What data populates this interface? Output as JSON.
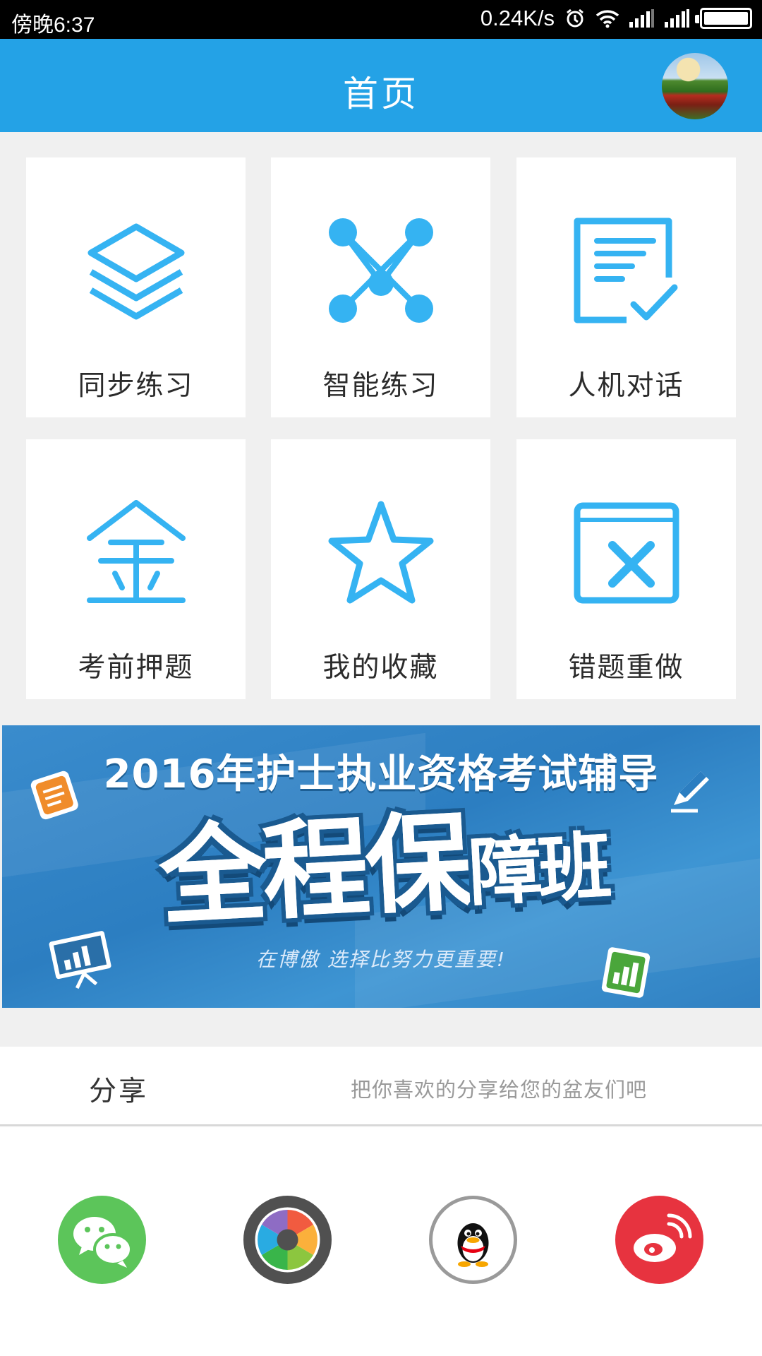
{
  "status_bar": {
    "time": "傍晚6:37",
    "speed": "0.24K/s"
  },
  "header": {
    "title": "首页"
  },
  "menu": [
    {
      "label": "同步练习",
      "icon": "layers-icon"
    },
    {
      "label": "智能练习",
      "icon": "network-nodes-icon"
    },
    {
      "label": "人机对话",
      "icon": "document-check-icon"
    },
    {
      "label": "考前押题",
      "icon": "gold-character-icon"
    },
    {
      "label": "我的收藏",
      "icon": "star-icon"
    },
    {
      "label": "错题重做",
      "icon": "book-x-icon"
    }
  ],
  "banner": {
    "headline": "2016年护士执业资格考试辅导",
    "big_text": "全程保",
    "big_text_small": "障班",
    "slogan": "在博傲   选择比努力更重要!"
  },
  "share": {
    "title": "分享",
    "hint": "把你喜欢的分享给您的盆友们吧",
    "targets": [
      {
        "name": "wechat",
        "icon": "wechat-icon",
        "color": "#5cc55a"
      },
      {
        "name": "moments",
        "icon": "moments-icon",
        "color": "#505050"
      },
      {
        "name": "qq",
        "icon": "qq-icon",
        "color": "#ffffff"
      },
      {
        "name": "weibo",
        "icon": "weibo-icon",
        "color": "#e7333f"
      }
    ]
  },
  "colors": {
    "primary": "#24a2e6",
    "icon_blue": "#35b3f2"
  }
}
